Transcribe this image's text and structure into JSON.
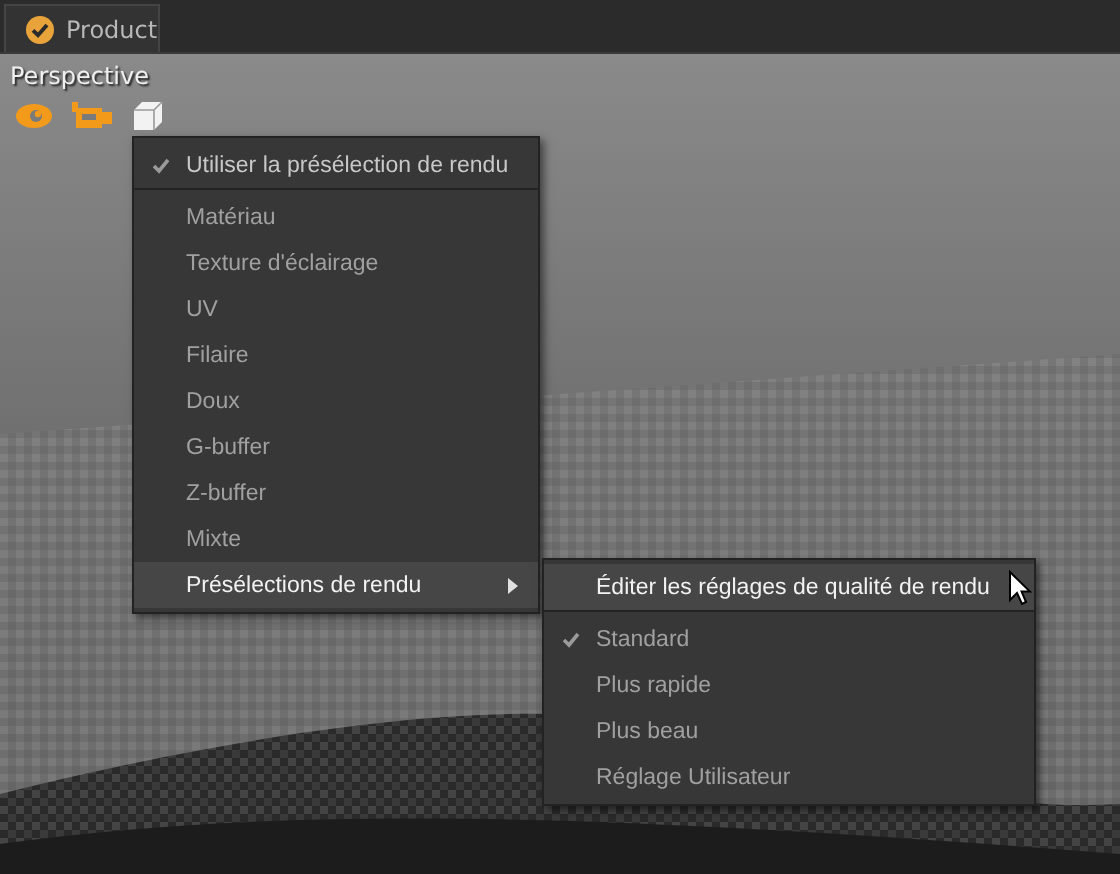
{
  "tab": {
    "label": "Product"
  },
  "viewport": {
    "label": "Perspective"
  },
  "menu": {
    "items": [
      {
        "label": "Utiliser la présélection de rendu",
        "kind": "toggle",
        "checked": true,
        "selected": false
      },
      {
        "label": "Matériau",
        "kind": "item",
        "checked": false,
        "selected": false
      },
      {
        "label": "Texture d'éclairage",
        "kind": "item",
        "checked": false,
        "selected": false
      },
      {
        "label": "UV",
        "kind": "item",
        "checked": false,
        "selected": false
      },
      {
        "label": "Filaire",
        "kind": "item",
        "checked": false,
        "selected": false
      },
      {
        "label": "Doux",
        "kind": "item",
        "checked": false,
        "selected": false
      },
      {
        "label": "G-buffer",
        "kind": "item",
        "checked": false,
        "selected": false
      },
      {
        "label": "Z-buffer",
        "kind": "item",
        "checked": false,
        "selected": false
      },
      {
        "label": "Mixte",
        "kind": "item",
        "checked": false,
        "selected": false
      },
      {
        "label": "Présélections de rendu",
        "kind": "submenu",
        "checked": false,
        "selected": true
      }
    ]
  },
  "submenu": {
    "items": [
      {
        "label": "Éditer les réglages de qualité de rendu",
        "kind": "toggle",
        "checked": false,
        "selected": true
      },
      {
        "label": "Standard",
        "kind": "item",
        "checked": true,
        "selected": false
      },
      {
        "label": "Plus rapide",
        "kind": "item",
        "checked": false,
        "selected": false
      },
      {
        "label": "Plus beau",
        "kind": "item",
        "checked": false,
        "selected": false
      },
      {
        "label": "Réglage Utilisateur",
        "kind": "item",
        "checked": false,
        "selected": false
      }
    ]
  }
}
